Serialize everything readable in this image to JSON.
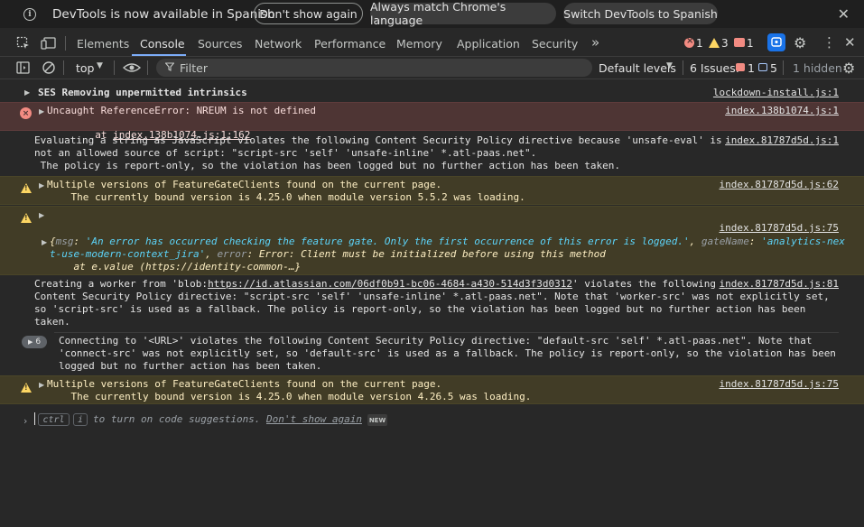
{
  "infobar": {
    "message": "DevTools is now available in Spanish",
    "btn_dont_show": "Don't show again",
    "btn_always_match": "Always match Chrome's language",
    "btn_switch": "Switch DevTools to Spanish",
    "close": "✕"
  },
  "tabs": [
    {
      "label": "Elements"
    },
    {
      "label": "Console"
    },
    {
      "label": "Sources"
    },
    {
      "label": "Network"
    },
    {
      "label": "Performance"
    },
    {
      "label": "Memory"
    },
    {
      "label": "Application"
    },
    {
      "label": "Security"
    }
  ],
  "tab_status": {
    "errors": "1",
    "warnings": "3",
    "issues": "1"
  },
  "toolbar": {
    "context": "top",
    "filter_placeholder": "Filter",
    "levels": "Default levels",
    "issues_label": "6 Issues:",
    "issues_err": "1",
    "issues_info": "5",
    "hidden": "1 hidden"
  },
  "messages": {
    "m1": {
      "text": "SES Removing unpermitted intrinsics",
      "src": "lockdown-install.js:1"
    },
    "m2": {
      "l1": "Uncaught ReferenceError: NREUM is not defined",
      "l2_prefix": "    at ",
      "l2_link": "index.138b1074.js:1:162",
      "src": "index.138b1074.js:1"
    },
    "m3": {
      "l1": "Evaluating a string as JavaScript violates the following Content Security Policy directive because 'unsafe-eval' is",
      "l2": "not an allowed source of script: \"script-src 'self' 'unsafe-inline' *.atl-paas.net\".",
      "l3": " The policy is report-only, so the violation has been logged but no further action has been taken.",
      "src": "index.81787d5d.js:1"
    },
    "m4": {
      "l1": "Multiple versions of FeatureGateClients found on the current page.",
      "l2": "    The currently bound version is 4.25.0 when module version 5.5.2 was loading.",
      "src": "index.81787d5d.js:62"
    },
    "m5": {
      "src": "index.81787d5d.js:75",
      "k_msg": "msg",
      "v_msg": "'An error has occurred checking the feature gate. Only the first occurrence of this error is logged.'",
      "k_gate": "gateName",
      "v_gate": "'analytics-nex",
      "v_gate2": "t-use-modern-context_jira'",
      "k_error": "error",
      "v_error": "Error: Client must be initialized before using this method",
      "v_error2": "    at e.value (https://identity-common-…}"
    },
    "m6": {
      "l1_prefix": "Creating a worker from 'blob:",
      "l1_link": "https://id.atlassian.com/06df0b91-bc06-4684-a430-514d3f3d0312",
      "l1_suffix": "' violates the following",
      "l2": "Content Security Policy directive: \"script-src 'self' 'unsafe-inline' *.atl-paas.net\". Note that 'worker-src' was not explicitly set,",
      "l3": "so 'script-src' is used as a fallback. The policy is report-only, so the violation has been logged but no further action has been",
      "l4": "taken.",
      "src": "index.81787d5d.js:81"
    },
    "m7": {
      "count": "6",
      "l1": "Connecting to '<URL>' violates the following Content Security Policy directive: \"default-src 'self' *.atl-paas.net\". Note that",
      "l2": "'connect-src' was not explicitly set, so 'default-src' is used as a fallback. The policy is report-only, so the violation has been",
      "l3": "logged but no further action has been taken."
    },
    "m8": {
      "l1": "Multiple versions of FeatureGateClients found on the current page.",
      "l2": "    The currently bound version is 4.25.0 when module version 4.26.5 was loading.",
      "src": "index.81787d5d.js:75"
    }
  },
  "prompt": {
    "key1": "ctrl",
    "key2": "i",
    "hint": "to turn on code suggestions.",
    "dont_show": "Don't show again",
    "new": "NEW"
  }
}
